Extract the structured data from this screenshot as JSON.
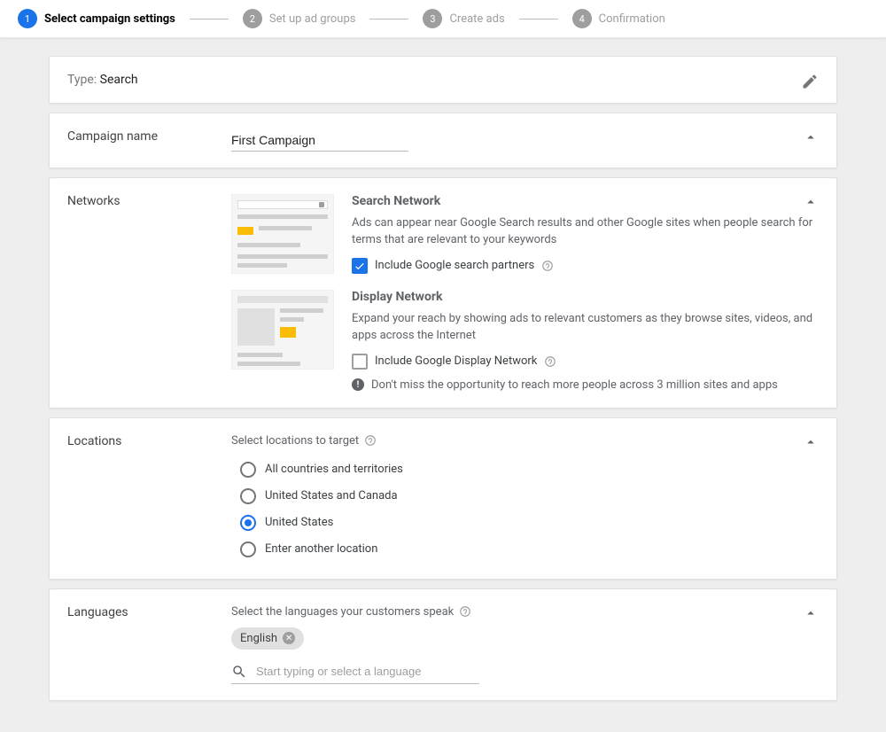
{
  "stepper": {
    "steps": [
      {
        "num": "1",
        "label": "Select campaign settings"
      },
      {
        "num": "2",
        "label": "Set up ad groups"
      },
      {
        "num": "3",
        "label": "Create ads"
      },
      {
        "num": "4",
        "label": "Confirmation"
      }
    ]
  },
  "type_card": {
    "label": "Type: ",
    "value": "Search"
  },
  "campaign_name": {
    "title": "Campaign name",
    "value": "First Campaign"
  },
  "networks": {
    "title": "Networks",
    "search": {
      "heading": "Search Network",
      "desc": "Ads can appear near Google Search results and other Google sites when people search for terms that are relevant to your keywords",
      "checkbox_label": "Include Google search partners"
    },
    "display": {
      "heading": "Display Network",
      "desc": "Expand your reach by showing ads to relevant customers as they browse sites, videos, and apps across the Internet",
      "checkbox_label": "Include Google Display Network",
      "tip": "Don't miss the opportunity to reach more people across 3 million sites and apps"
    }
  },
  "locations": {
    "title": "Locations",
    "prompt": "Select locations to target",
    "options": [
      "All countries and territories",
      "United States and Canada",
      "United States",
      "Enter another location"
    ]
  },
  "languages": {
    "title": "Languages",
    "prompt": "Select the languages your customers speak",
    "chip": "English",
    "placeholder": "Start typing or select a language"
  }
}
